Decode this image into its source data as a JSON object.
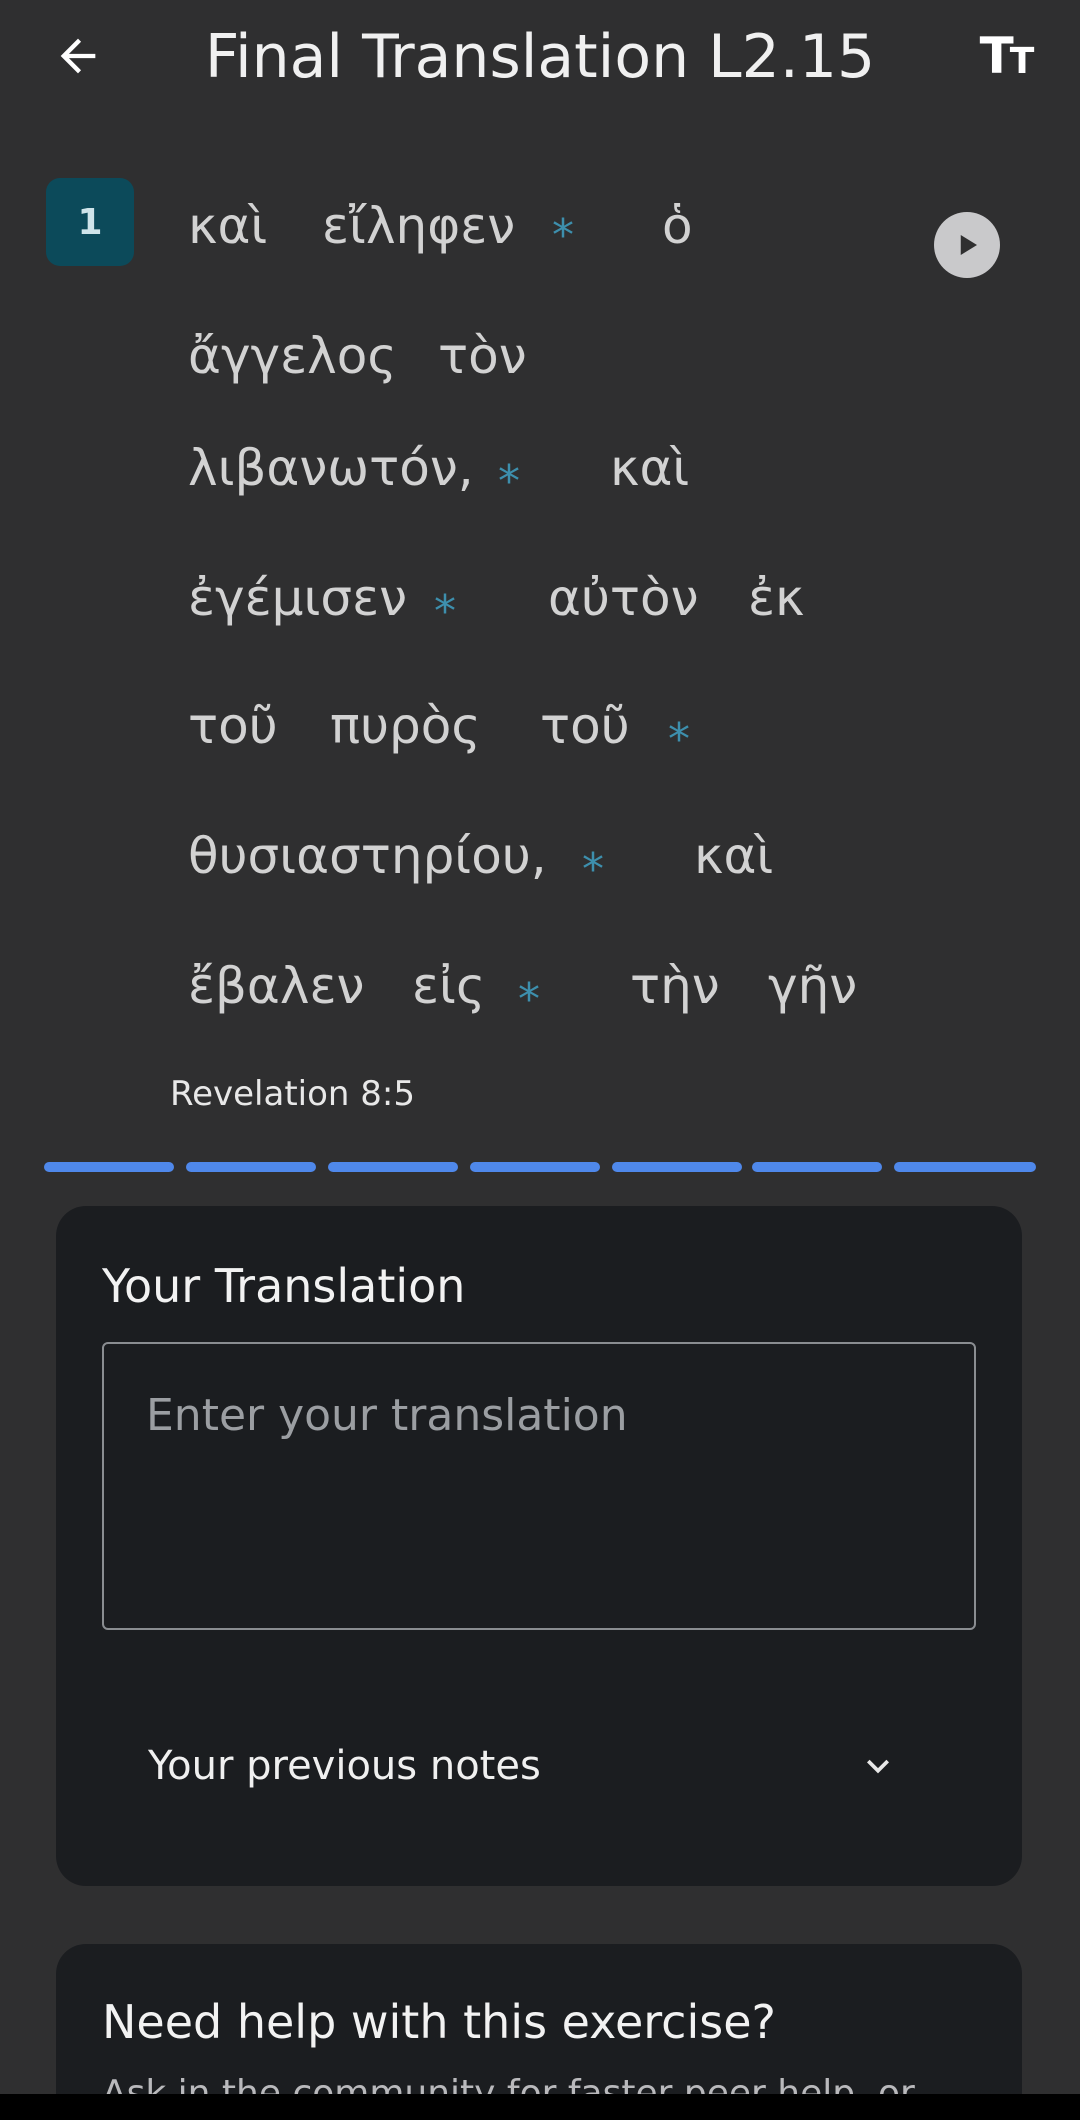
{
  "header": {
    "title": "Final Translation L2.15",
    "back_icon": "arrow-left-icon",
    "text_size_icon": "text-size-icon",
    "text_size_glyph_big": "T",
    "text_size_glyph_small": "T"
  },
  "verse": {
    "number": "1",
    "play_icon": "play-icon",
    "reference": "Revelation 8:5",
    "lines": [
      [
        "καὶ",
        "εἴληφεν",
        "*",
        "ὁ"
      ],
      [
        "ἄγγελος",
        "τὸν"
      ],
      [
        "λιβανωτόν,",
        "*",
        "καὶ"
      ],
      [
        "ἐγέμισεν",
        "*",
        "αὐτὸν",
        "ἐκ"
      ],
      [
        "τοῦ",
        "πυρὸς",
        "τοῦ",
        "*"
      ],
      [
        "θυσιαστηρίου,",
        "*",
        "καὶ"
      ],
      [
        "ἔβαλεν",
        "εἰς",
        "*",
        "τὴν",
        "γῆν"
      ]
    ]
  },
  "progress": {
    "segments": 7,
    "completed": 7,
    "color": "#4f88ea"
  },
  "translation_card": {
    "title": "Your Translation",
    "input_value": "",
    "input_placeholder": "Enter your translation",
    "notes_label": "Your previous notes",
    "notes_icon": "chevron-down-icon"
  },
  "help_card": {
    "title": "Need help with this exercise?",
    "subtitle": "Ask in the community for faster peer help, or"
  },
  "colors": {
    "background": "#2f2f30",
    "card": "#1b1d20",
    "badge": "#0c4a5a",
    "marker": "#3d8fad"
  }
}
